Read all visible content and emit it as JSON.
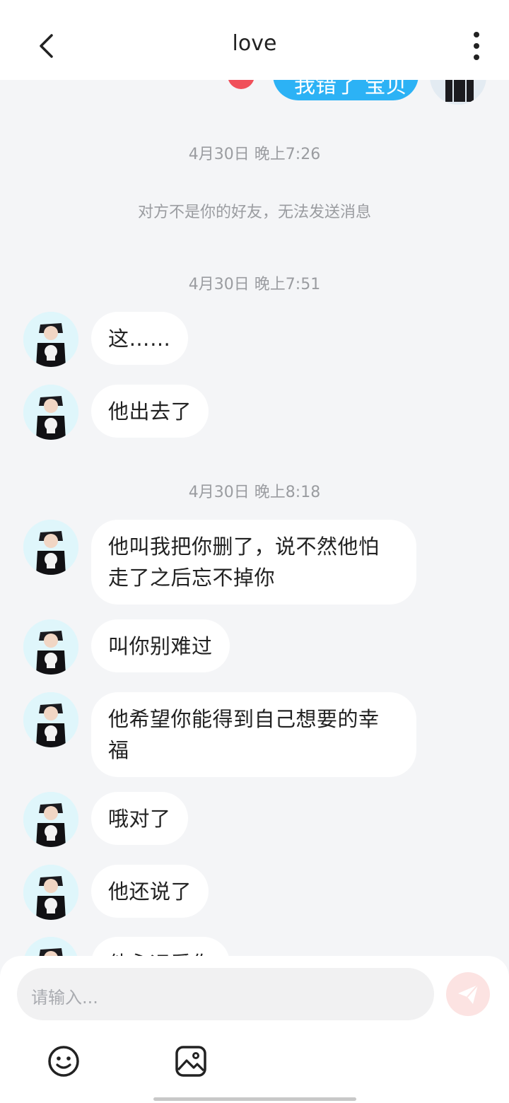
{
  "header": {
    "title": "love"
  },
  "peek": {
    "bubble_text": "我错了 宝贝"
  },
  "timestamps": [
    "4月30日 晚上7:26",
    "4月30日 晚上7:51",
    "4月30日 晚上8:18"
  ],
  "system_notice": "对方不是你的好友，无法发送消息",
  "messages": [
    {
      "text": "这……"
    },
    {
      "text": "他出去了"
    },
    {
      "text": "他叫我把你删了，说不然他怕走了之后忘不掉你"
    },
    {
      "text": "叫你别难过"
    },
    {
      "text": "他希望你能得到自己想要的幸福"
    },
    {
      "text": "哦对了"
    },
    {
      "text": "他还说了"
    },
    {
      "text": "他永远爱你"
    }
  ],
  "input": {
    "placeholder": "请输入..."
  },
  "icons": {
    "back": "chevron-left-icon",
    "more": "more-vertical-icon",
    "send": "send-icon",
    "emoji": "emoji-icon",
    "image": "image-icon"
  },
  "colors": {
    "sent_bubble": "#2cb2f5",
    "received_bubble": "#ffffff",
    "background": "#f4f5f7",
    "send_button": "#fce3e2"
  }
}
